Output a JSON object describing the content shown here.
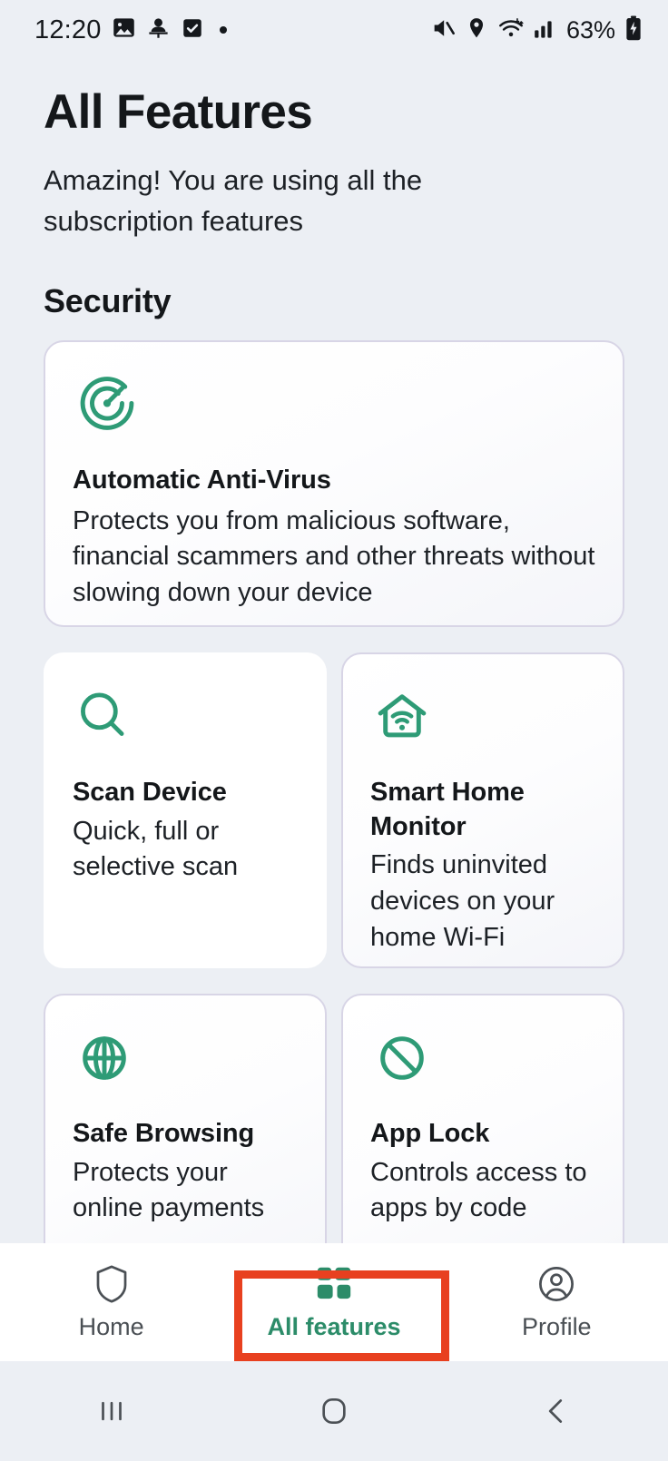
{
  "status_bar": {
    "time": "12:20",
    "left_icons": [
      "photo-icon",
      "person-pin-icon",
      "checkbox-icon",
      "dot-icon"
    ],
    "right_icons": [
      "mute-icon",
      "location-icon",
      "wifi-icon",
      "signal-icon"
    ],
    "battery_text": "63%",
    "battery_icon": "battery-charging-icon"
  },
  "header": {
    "title": "All Features",
    "subtitle": "Amazing! You are using all the subscription features"
  },
  "sections": [
    {
      "title": "Security",
      "featured_card": {
        "icon": "radar-scan-icon",
        "title": "Automatic Anti-Virus",
        "description": "Protects you from malicious software, financial scammers and other threats without slowing down your device"
      },
      "cards": [
        {
          "icon": "magnifier-icon",
          "title": "Scan Device",
          "description": "Quick, full or selective scan",
          "style": "plain"
        },
        {
          "icon": "home-wifi-icon",
          "title": "Smart Home Monitor",
          "description": "Finds uninvited devices on your home Wi-Fi",
          "style": "bordered"
        },
        {
          "icon": "globe-icon",
          "title": "Safe Browsing",
          "description": "Protects your online payments",
          "style": "bordered"
        },
        {
          "icon": "block-icon",
          "title": "App Lock",
          "description": "Controls access to apps by code",
          "style": "bordered"
        }
      ]
    }
  ],
  "bottom_nav": {
    "items": [
      {
        "label": "Home",
        "icon": "shield-icon",
        "active": false
      },
      {
        "label": "All features",
        "icon": "grid-icon",
        "active": true
      },
      {
        "label": "Profile",
        "icon": "account-circle-icon",
        "active": false
      }
    ]
  },
  "system_nav": {
    "buttons": [
      "recents-icon",
      "home-circle-icon",
      "back-icon"
    ]
  },
  "colors": {
    "accent_green": "#2e9b76",
    "active_nav_green": "#2c8c69",
    "background": "#eceff4",
    "card_border": "#d8d5e6",
    "text_primary": "#14171a",
    "highlight_red": "#e8401f"
  }
}
